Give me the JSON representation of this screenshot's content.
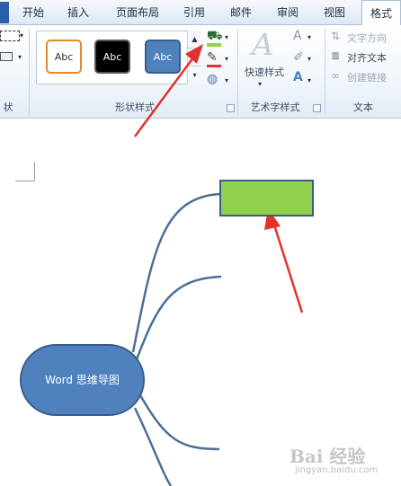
{
  "tabs": [
    {
      "label": "开始"
    },
    {
      "label": "插入"
    },
    {
      "label": "页面布局"
    },
    {
      "label": "引用"
    },
    {
      "label": "邮件"
    },
    {
      "label": "审阅"
    },
    {
      "label": "视图"
    },
    {
      "label": "格式",
      "active": true
    }
  ],
  "ribbon": {
    "left_group_label": "状",
    "shape_styles": {
      "label": "形状样式",
      "swatches": [
        {
          "text": "Abc",
          "fill": "#ffffff",
          "border": "#e08b2f"
        },
        {
          "text": "Abc",
          "fill": "#000000",
          "border": "#555555"
        },
        {
          "text": "Abc",
          "fill": "#4f81bd",
          "border": "#385d8a"
        }
      ]
    },
    "wordart": {
      "label": "艺术字样式",
      "quick_styles": "快速样式"
    },
    "text": {
      "label": "文本",
      "direction": "文字方向",
      "align": "对齐文本",
      "link": "创建链接"
    }
  },
  "mindmap": {
    "center_label": "Word 思维导图",
    "center_color": "#4f81bd",
    "leaf_color": "#92d050",
    "line_color": "#4a6f97"
  },
  "annotation_color": "#e3322b",
  "watermark": {
    "brand": "Bai 经验",
    "url": "jingyan.baidu.com"
  }
}
